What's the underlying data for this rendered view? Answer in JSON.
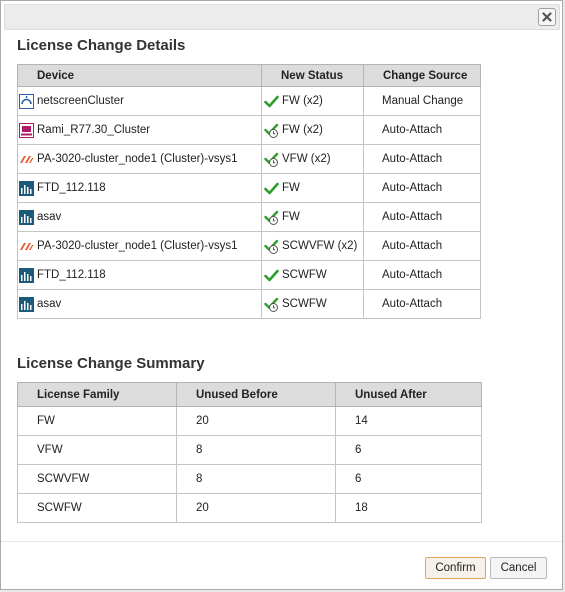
{
  "details": {
    "title": "License Change Details",
    "headers": [
      "Device",
      "New Status",
      "Change Source"
    ],
    "rows": [
      {
        "device": "netscreenCluster",
        "device_icon": "netscreen-icon",
        "status": "FW (x2)",
        "status_icon": "check-icon",
        "source": "Manual Change"
      },
      {
        "device": "Rami_R77.30_Cluster",
        "device_icon": "checkpoint-icon",
        "status": "FW (x2)",
        "status_icon": "check-clock-icon",
        "source": "Auto-Attach"
      },
      {
        "device": "PA-3020-cluster_node1 (Cluster)-vsys1",
        "device_icon": "paloalto-icon",
        "status": "VFW (x2)",
        "status_icon": "check-clock-icon",
        "source": "Auto-Attach"
      },
      {
        "device": "FTD_112.118",
        "device_icon": "cisco-icon",
        "status": "FW",
        "status_icon": "check-icon",
        "source": "Auto-Attach"
      },
      {
        "device": "asav",
        "device_icon": "cisco-icon",
        "status": "FW",
        "status_icon": "check-clock-icon",
        "source": "Auto-Attach"
      },
      {
        "device": "PA-3020-cluster_node1 (Cluster)-vsys1",
        "device_icon": "paloalto-icon",
        "status": "SCWVFW (x2)",
        "status_icon": "check-clock-icon",
        "source": "Auto-Attach"
      },
      {
        "device": "FTD_112.118",
        "device_icon": "cisco-icon",
        "status": "SCWFW",
        "status_icon": "check-icon",
        "source": "Auto-Attach"
      },
      {
        "device": "asav",
        "device_icon": "cisco-icon",
        "status": "SCWFW",
        "status_icon": "check-clock-icon",
        "source": "Auto-Attach"
      }
    ]
  },
  "summary": {
    "title": "License Change Summary",
    "headers": [
      "License Family",
      "Unused Before",
      "Unused After"
    ],
    "rows": [
      {
        "family": "FW",
        "before": "20",
        "after": "14"
      },
      {
        "family": "VFW",
        "before": "8",
        "after": "6"
      },
      {
        "family": "SCWVFW",
        "before": "8",
        "after": "6"
      },
      {
        "family": "SCWFW",
        "before": "20",
        "after": "18"
      }
    ]
  },
  "buttons": {
    "confirm": "Confirm",
    "cancel": "Cancel"
  },
  "colors": {
    "check": "#2e9e2e",
    "confirm_border": "#e1a35b"
  }
}
